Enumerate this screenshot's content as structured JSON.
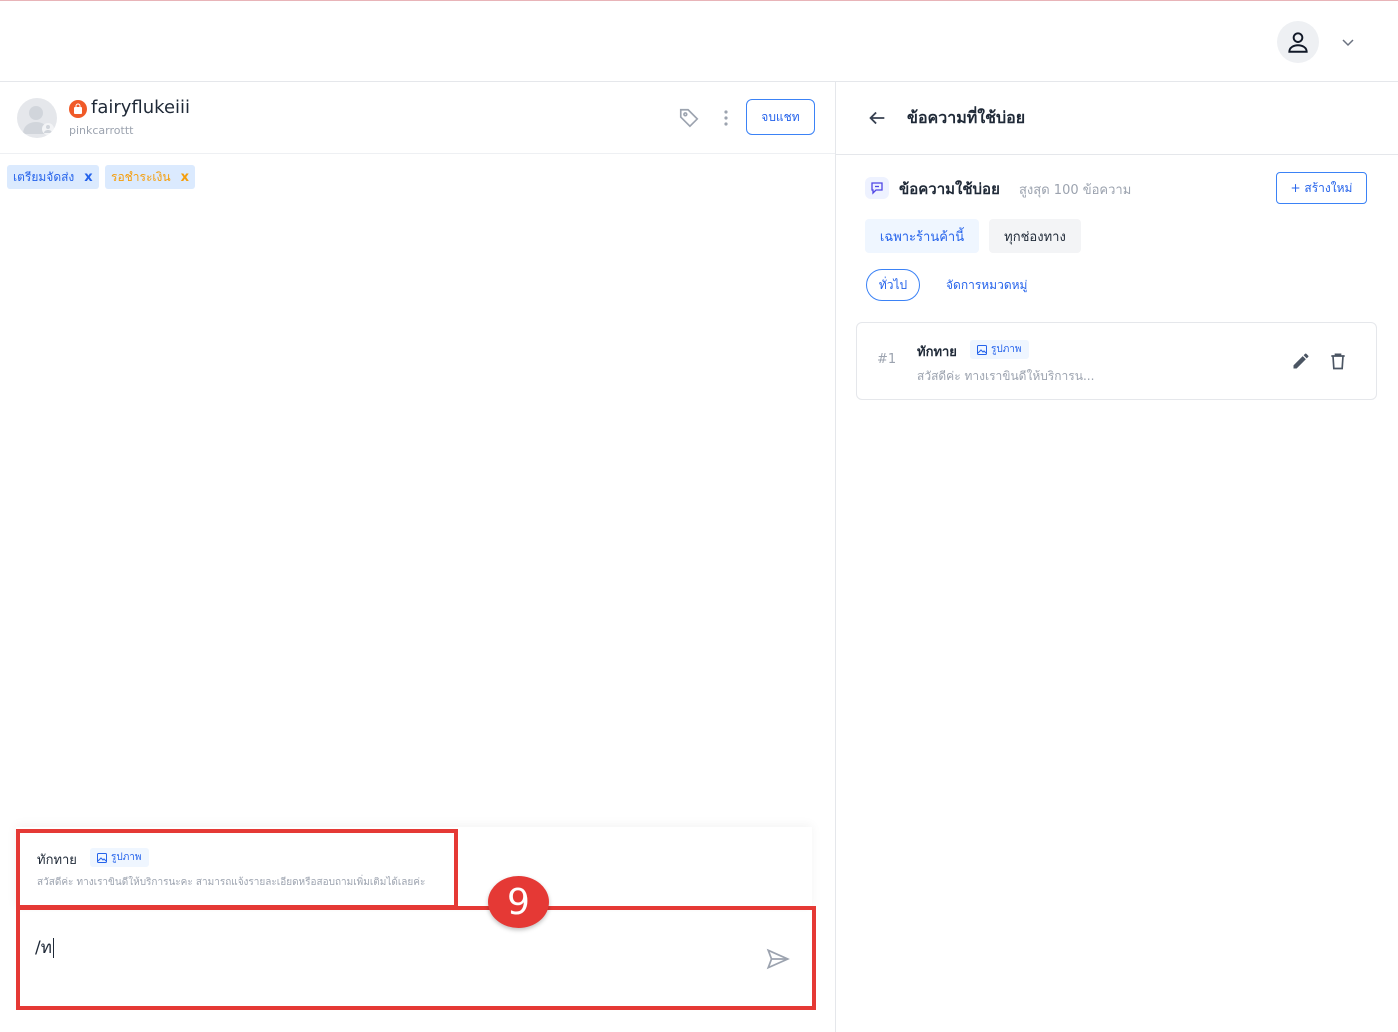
{
  "chat": {
    "customer_name": "fairyflukeiii",
    "customer_handle": "pinkcarrottt",
    "end_chat_label": "จบแชท",
    "tags": [
      {
        "label": "เตรียมจัดส่ง",
        "remove": "x"
      },
      {
        "label": "รอชำระเงิน",
        "remove": "x"
      }
    ]
  },
  "suggestion": {
    "title": "ทักทาย",
    "badge": "รูปภาพ",
    "text": "สวัสดีค่ะ ทางเราขินดีให้บริการนะคะ สามารถแจ้งรายละเอียดหรือสอบถามเพิ่มเติมได้เลยค่ะ"
  },
  "composer": {
    "value": "/ท"
  },
  "annotation": {
    "step": "9"
  },
  "quick_replies": {
    "panel_title": "ข้อความที่ใช้บ่อย",
    "section_title": "ข้อความใช้บ่อย",
    "section_sub": "สูงสุด 100 ข้อความ",
    "new_label": "+ สร้างใหม่",
    "tabs": [
      "เฉพาะร้านค้านี้",
      "ทุกช่องทาง"
    ],
    "category_active": "ทั่วไป",
    "category_manage": "จัดการหมวดหมู่",
    "items": [
      {
        "num": "#1",
        "title": "ทักทาย",
        "badge": "รูปภาพ",
        "text": "สวัสดีค่ะ ทางเราขินดีให้บริการน..."
      }
    ]
  },
  "colors": {
    "accent": "#2563eb",
    "highlight": "#e53935",
    "shop_badge": "#f05a28"
  }
}
